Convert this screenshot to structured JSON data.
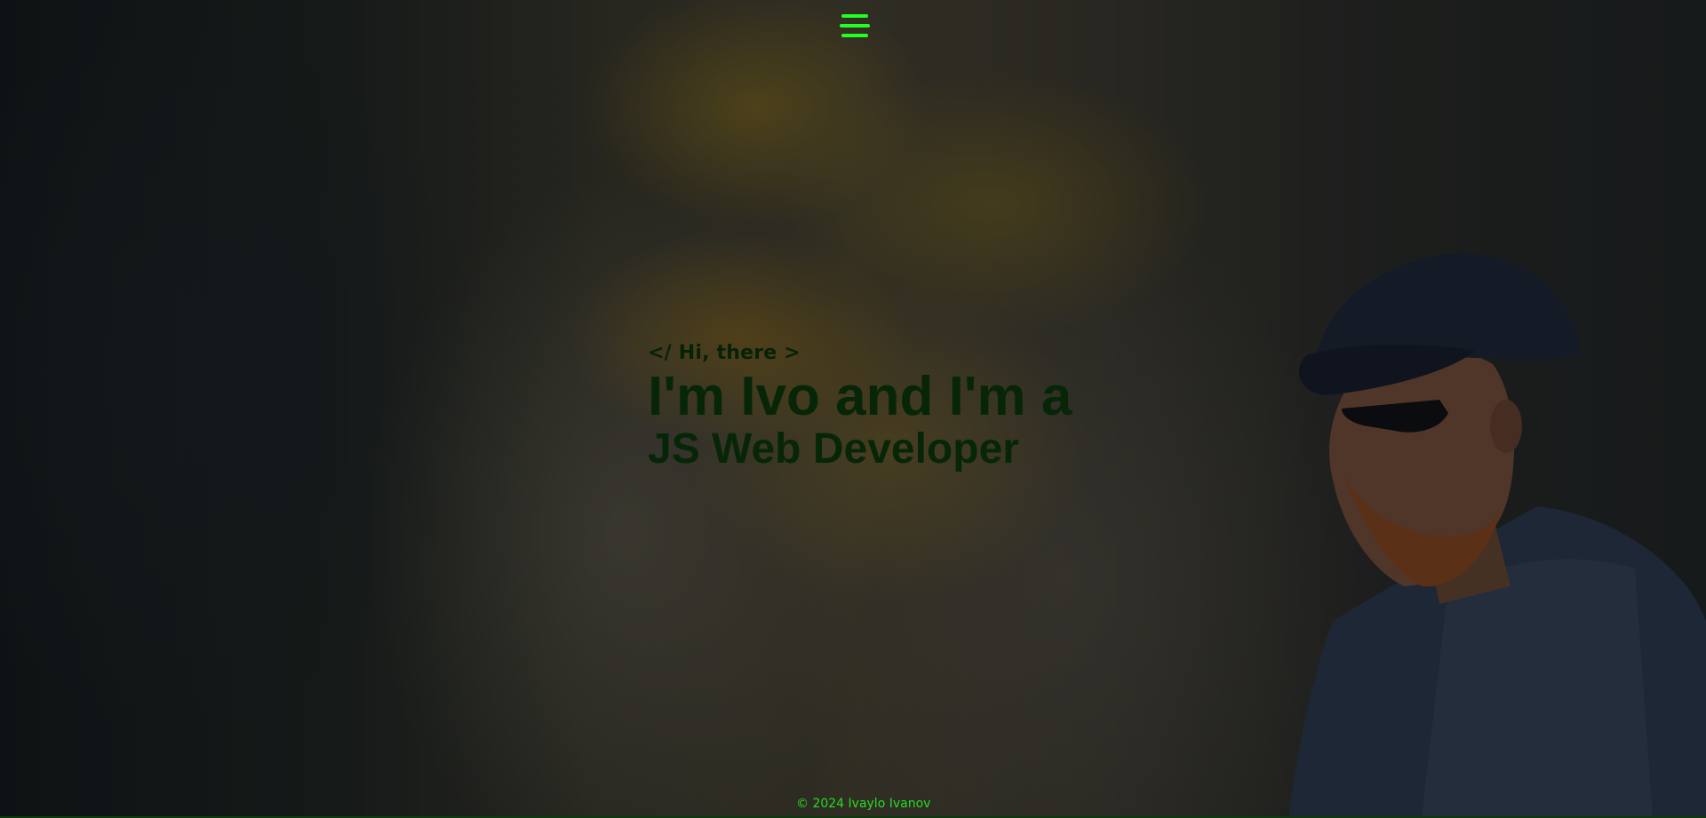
{
  "header": {
    "menu_icon": "hamburger-menu-icon",
    "menu_color": "#22ff22"
  },
  "hero": {
    "greeting": "</ Hi, there >",
    "headline_line1": "I'm Ivo and I'm a",
    "headline_line2": "JS Web Developer",
    "text_color": "#072607"
  },
  "footer": {
    "copyright": "© 2024 Ivaylo Ivanov",
    "text_color": "#22dd22"
  }
}
